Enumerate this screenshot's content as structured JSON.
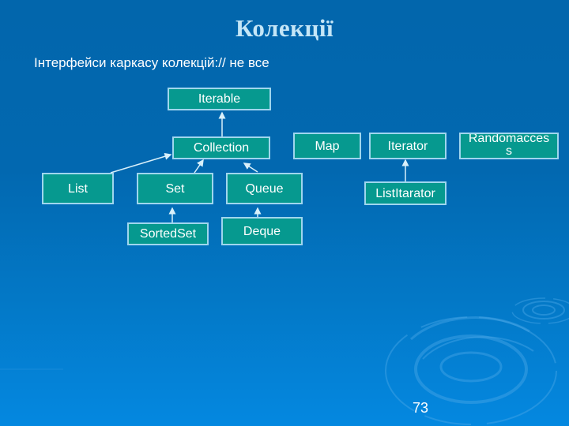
{
  "slide": {
    "title": "Колекції",
    "subtitle": "Інтерфейси каркасу колекцій:// не все",
    "page_number": "73"
  },
  "diagram": {
    "nodes": {
      "iterable": "Iterable",
      "collection": "Collection",
      "list": "List",
      "set": "Set",
      "queue": "Queue",
      "sortedset": "SortedSet",
      "deque": "Deque",
      "map": "Map",
      "iterator": "Iterator",
      "randomaccess": "Randomaccess",
      "listiterator": "ListItarator"
    },
    "edges": [
      {
        "from": "Collection",
        "to": "Iterable"
      },
      {
        "from": "List",
        "to": "Collection"
      },
      {
        "from": "Set",
        "to": "Collection"
      },
      {
        "from": "Queue",
        "to": "Collection"
      },
      {
        "from": "SortedSet",
        "to": "Set"
      },
      {
        "from": "Deque",
        "to": "Queue"
      },
      {
        "from": "ListItarator",
        "to": "Iterator"
      }
    ]
  },
  "colors": {
    "node_fill": "#06998f",
    "node_border": "#9fd6ee",
    "title_text": "#c4e6f7",
    "edge": "#d8f0fa"
  }
}
